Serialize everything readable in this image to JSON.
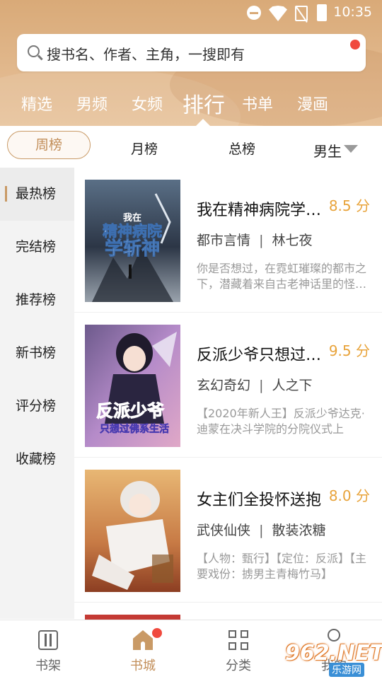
{
  "status_bar": {
    "time": "10:35"
  },
  "search": {
    "placeholder": "搜书名、作者、主角，一搜即有"
  },
  "top_tabs": [
    {
      "label": "精选"
    },
    {
      "label": "男频"
    },
    {
      "label": "女频"
    },
    {
      "label": "排行",
      "active": true
    },
    {
      "label": "书单"
    },
    {
      "label": "漫画"
    }
  ],
  "period_filters": [
    {
      "label": "周榜",
      "active": true
    },
    {
      "label": "月榜"
    },
    {
      "label": "总榜"
    }
  ],
  "gender_filter": {
    "label": "男生"
  },
  "sidebar": [
    {
      "label": "最热榜",
      "active": true
    },
    {
      "label": "完结榜"
    },
    {
      "label": "推荐榜"
    },
    {
      "label": "新书榜"
    },
    {
      "label": "评分榜"
    },
    {
      "label": "收藏榜"
    }
  ],
  "books": [
    {
      "title": "我在精神病院学斩神",
      "score": "8.5 分",
      "genre": "都市言情",
      "author": "林七夜",
      "desc": "你是否想过，在霓虹璀璨的都市之下，潜藏着来自古老神话里的怪物？",
      "cover_text": [
        "我在",
        "精神病院",
        "学斩神"
      ]
    },
    {
      "title": "反派少爷只想过佛系生活",
      "score": "9.5 分",
      "genre": "玄幻奇幻",
      "author": "人之下",
      "desc": "【2020年新人王】反派少爷达克·迪蒙在决斗学院的分院仪式上",
      "cover_text": [
        "反派少爷",
        "只想过佛系生活"
      ]
    },
    {
      "title": "女主们全投怀送抱",
      "score": "8.0 分",
      "genre": "武侠仙侠",
      "author": "散装浓糖",
      "desc": "【人物：甄行】【定位：反派】【主要戏份：掳男主青梅竹马】",
      "cover_text": []
    }
  ],
  "bottom_nav": [
    {
      "label": "书架",
      "icon": "bookshelf-icon"
    },
    {
      "label": "书城",
      "icon": "home-icon",
      "active": true,
      "badge": true
    },
    {
      "label": "分类",
      "icon": "category-icon"
    },
    {
      "label": "我的",
      "icon": "profile-icon"
    }
  ],
  "watermark": {
    "main": "962.NET",
    "sub": "乐游网"
  },
  "colors": {
    "accent": "#c28e59",
    "header": "#d9aa78",
    "score": "#e8a33a",
    "badge": "#f04a3e"
  }
}
